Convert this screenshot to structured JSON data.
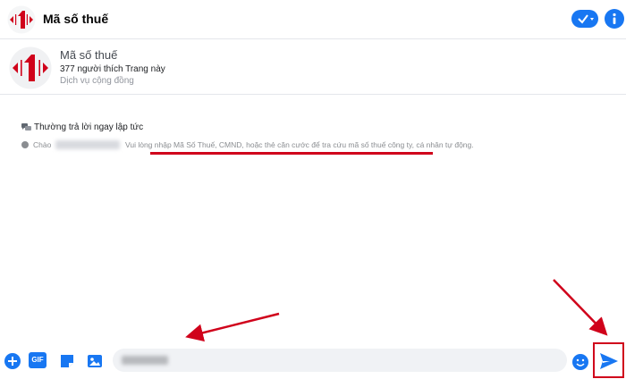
{
  "header": {
    "title": "Mã số thuế",
    "check_icon": "check-dropdown-icon",
    "info_icon": "info-icon"
  },
  "profile": {
    "name": "Mã số thuế",
    "likes": "377 người thích Trang này",
    "category": "Dịch vụ cộng đồng"
  },
  "conversation": {
    "reply_time": "Thường trả lời ngay lập tức",
    "greeting_hello": "Chào",
    "greeting_message": "Vui lòng nhập Mã Số Thuế, CMND, hoặc thẻ căn cước để tra cứu mã số thuế công ty, cá nhân tự động."
  },
  "composer": {
    "gif_label": "GIF",
    "icons": [
      "plus-icon",
      "gif-icon",
      "sticker-icon",
      "photo-icon",
      "emoji-icon",
      "send-icon"
    ]
  },
  "colors": {
    "accent": "#1877f2",
    "brand_red": "#d0021b",
    "annotation_red": "#d0021b"
  }
}
